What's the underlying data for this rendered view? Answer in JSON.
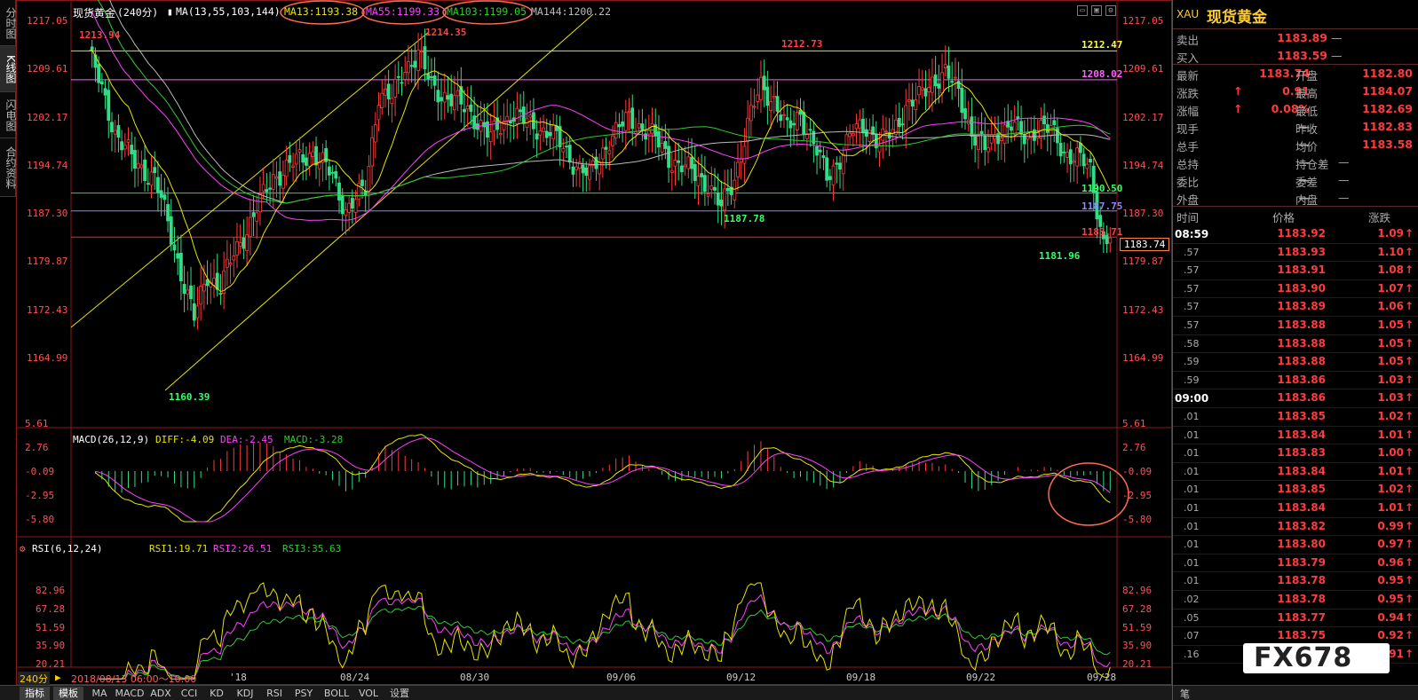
{
  "left_tabs": [
    "分时图",
    "K线图",
    "闪电图",
    "合约资料"
  ],
  "header": {
    "name": "现货黄金",
    "period": "(240分)",
    "ma_label": "MA(13,55,103,144)",
    "ma13": "MA13:1193.38",
    "ma55": "MA55:1199.33",
    "ma103": "MA103:1199.05",
    "ma144": "MA144:1200.22"
  },
  "colors": {
    "up": "#ff3b3b",
    "down": "#33dd88",
    "ma13": "#e5e500",
    "ma55": "#ff40ff",
    "ma103": "#2ecc2e",
    "ma144": "#bbbbbb"
  },
  "price_axis": [
    "1217.05",
    "1209.61",
    "1202.17",
    "1194.74",
    "1187.30",
    "1179.87",
    "1172.43",
    "1164.99"
  ],
  "price_annotations": {
    "high_left": "1213.94",
    "high_mid": "1214.35",
    "high_right": "1212.73",
    "low_left": "1160.39",
    "low_mid": "1187.78",
    "low_right": "1181.96",
    "line_yellow": "1212.47",
    "line_magenta": "1208.02",
    "line_green": "1190.50",
    "line_blue": "1187.75",
    "line_red": "1183.71",
    "current_box": "1183.74"
  },
  "macd": {
    "label": "MACD(26,12,9)",
    "diff": "DIFF:-4.09",
    "dea": "DEA:-2.45",
    "macd": "MACD:-3.28",
    "axis": [
      "5.61",
      "2.76",
      "-0.09",
      "-2.95",
      "-5.80"
    ]
  },
  "rsi": {
    "label": "RSI(6,12,24)",
    "rsi1": "RSI1:19.71",
    "rsi2": "RSI2:26.51",
    "rsi3": "RSI3:35.63",
    "axis": [
      "82.96",
      "67.28",
      "51.59",
      "35.90",
      "20.21"
    ]
  },
  "date_axis": {
    "period_label": "240分",
    "range": "2018/08/13 06:00～10:00",
    "dates": [
      "'18",
      "08/24",
      "08/30",
      "09/06",
      "09/12",
      "09/18",
      "09/22",
      "09/28"
    ]
  },
  "bottom_tabs": [
    "指标",
    "模板",
    "MA",
    "MACD",
    "ADX",
    "CCI",
    "KD",
    "KDJ",
    "RSI",
    "PSY",
    "BOLL",
    "VOL",
    "设置"
  ],
  "right_panel": {
    "symbol": "XAU",
    "name": "现货黄金",
    "sell_label": "卖出",
    "sell": "1183.89",
    "sell_vol": "—",
    "buy_label": "买入",
    "buy": "1183.59",
    "buy_vol": "—",
    "stats": [
      {
        "l1": "最新",
        "v1": "1183.74",
        "l2": "开盘",
        "v2": "1182.80"
      },
      {
        "l1": "涨跌",
        "v1": "0.91",
        "l2": "最高",
        "v2": "1184.07"
      },
      {
        "l1": "涨幅",
        "v1": "0.08%",
        "l2": "最低",
        "v2": "1182.69"
      },
      {
        "l1": "现手",
        "v1": "—",
        "l2": "昨收",
        "v2": "1182.83"
      },
      {
        "l1": "总手",
        "v1": "—",
        "l2": "均价",
        "v2": "1183.58"
      },
      {
        "l1": "总持",
        "v1": "—",
        "l2": "持仓差",
        "v2": "—"
      },
      {
        "l1": "委比",
        "v1": "—",
        "l2": "委差",
        "v2": "—"
      },
      {
        "l1": "外盘",
        "v1": "—",
        "l2": "内盘",
        "v2": "—"
      }
    ],
    "trade_headers": [
      "时间",
      "价格",
      "涨跌"
    ],
    "trades": [
      {
        "t": "08:59",
        "p": "1183.92",
        "c": "1.09"
      },
      {
        "t": ".57",
        "p": "1183.93",
        "c": "1.10"
      },
      {
        "t": ".57",
        "p": "1183.91",
        "c": "1.08"
      },
      {
        "t": ".57",
        "p": "1183.90",
        "c": "1.07"
      },
      {
        "t": ".57",
        "p": "1183.89",
        "c": "1.06"
      },
      {
        "t": ".57",
        "p": "1183.88",
        "c": "1.05"
      },
      {
        "t": ".58",
        "p": "1183.88",
        "c": "1.05"
      },
      {
        "t": ".59",
        "p": "1183.88",
        "c": "1.05"
      },
      {
        "t": ".59",
        "p": "1183.86",
        "c": "1.03"
      },
      {
        "t": "09:00",
        "p": "1183.86",
        "c": "1.03"
      },
      {
        "t": ".01",
        "p": "1183.85",
        "c": "1.02"
      },
      {
        "t": ".01",
        "p": "1183.84",
        "c": "1.01"
      },
      {
        "t": ".01",
        "p": "1183.83",
        "c": "1.00"
      },
      {
        "t": ".01",
        "p": "1183.84",
        "c": "1.01"
      },
      {
        "t": ".01",
        "p": "1183.85",
        "c": "1.02"
      },
      {
        "t": ".01",
        "p": "1183.84",
        "c": "1.01"
      },
      {
        "t": ".01",
        "p": "1183.82",
        "c": "0.99"
      },
      {
        "t": ".01",
        "p": "1183.80",
        "c": "0.97"
      },
      {
        "t": ".01",
        "p": "1183.79",
        "c": "0.96"
      },
      {
        "t": ".01",
        "p": "1183.78",
        "c": "0.95"
      },
      {
        "t": ".02",
        "p": "1183.78",
        "c": "0.95"
      },
      {
        "t": ".05",
        "p": "1183.77",
        "c": "0.94"
      },
      {
        "t": ".07",
        "p": "1183.75",
        "c": "0.92"
      },
      {
        "t": ".16",
        "p": "1183.74",
        "c": "0.91"
      }
    ],
    "footer_tab": "笔"
  },
  "watermark": "FX678",
  "window_icons": [
    "restore-icon",
    "window-icon",
    "settings-icon"
  ]
}
